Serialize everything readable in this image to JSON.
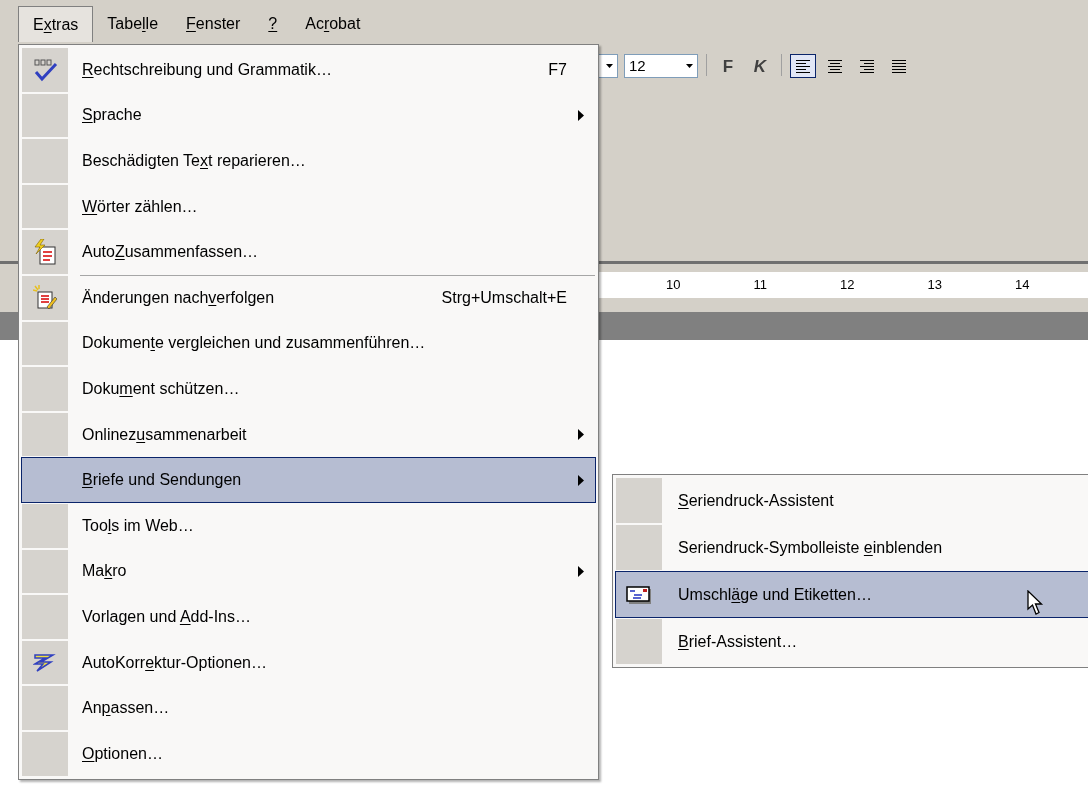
{
  "menubar": [
    {
      "label": {
        "pre": "E",
        "key": "x",
        "post": "tras"
      },
      "selected": true
    },
    {
      "label": {
        "pre": "Tabe",
        "key": "l",
        "post": "le"
      },
      "selected": false
    },
    {
      "label": {
        "key": "F",
        "post": "enster"
      },
      "selected": false
    },
    {
      "label": {
        "key": "?"
      },
      "selected": false
    },
    {
      "label": {
        "pre": "Ac",
        "key": "r",
        "post": "obat"
      },
      "selected": false
    }
  ],
  "toolbar": {
    "font_size": "12",
    "style_buttons": [
      {
        "label": "F",
        "kind": "bold"
      },
      {
        "label": "K",
        "kind": "italic"
      }
    ],
    "align_buttons": [
      {
        "kind": "left",
        "selected": true
      },
      {
        "kind": "center",
        "selected": false
      },
      {
        "kind": "right",
        "selected": false
      },
      {
        "kind": "justify",
        "selected": false
      }
    ]
  },
  "ruler": {
    "numbers": [
      "10",
      "11",
      "12",
      "13",
      "14"
    ]
  },
  "menu": {
    "items": [
      {
        "label": {
          "key": "R",
          "post": "echtschreibung und Grammatik…"
        },
        "shortcut": "F7",
        "has_submenu": false,
        "selected": false,
        "separator_before": false
      },
      {
        "label": {
          "key": "S",
          "post": "prache"
        },
        "has_submenu": true,
        "selected": false,
        "separator_before": false
      },
      {
        "label": {
          "pre": "Beschädigten Te",
          "key": "x",
          "post": "t reparieren…"
        },
        "has_submenu": false,
        "selected": false,
        "separator_before": false
      },
      {
        "label": {
          "key": "W",
          "post": "örter zählen…"
        },
        "has_submenu": false,
        "selected": false,
        "separator_before": false
      },
      {
        "label": {
          "pre": "Auto",
          "key": "Z",
          "post": "usammenfassen…"
        },
        "has_submenu": false,
        "selected": false,
        "separator_before": false
      },
      {
        "label": {
          "pre": "Änderungen nach",
          "key": "v",
          "post": "erfolgen"
        },
        "shortcut": "Strg+Umschalt+E",
        "has_submenu": false,
        "selected": false,
        "separator_before": true
      },
      {
        "label": {
          "pre": "Dokumen",
          "key": "t",
          "post": "e vergleichen und zusammenführen…"
        },
        "has_submenu": false,
        "selected": false,
        "separator_before": false
      },
      {
        "label": {
          "pre": "Doku",
          "key": "m",
          "post": "ent schützen…"
        },
        "has_submenu": false,
        "selected": false,
        "separator_before": false
      },
      {
        "label": {
          "pre": "Onlinez",
          "key": "u",
          "post": "sammenarbeit"
        },
        "has_submenu": true,
        "selected": false,
        "separator_before": false
      },
      {
        "label": {
          "key": "B",
          "post": "riefe und Sendungen"
        },
        "has_submenu": true,
        "selected": true,
        "separator_before": false
      },
      {
        "label": {
          "pre": "Too",
          "key": "l",
          "post": "s im Web…"
        },
        "has_submenu": false,
        "selected": false,
        "separator_before": false
      },
      {
        "label": {
          "pre": "Ma",
          "key": "k",
          "post": "ro"
        },
        "has_submenu": true,
        "selected": false,
        "separator_before": false
      },
      {
        "label": {
          "pre": "Vorlagen und ",
          "key": "A",
          "post": "dd-Ins…"
        },
        "has_submenu": false,
        "selected": false,
        "separator_before": false
      },
      {
        "label": {
          "pre": "AutoKorr",
          "key": "e",
          "post": "ktur-Optionen…"
        },
        "has_submenu": false,
        "selected": false,
        "separator_before": false
      },
      {
        "label": {
          "pre": "An",
          "key": "p",
          "post": "assen…"
        },
        "has_submenu": false,
        "selected": false,
        "separator_before": false
      },
      {
        "label": {
          "key": "O",
          "post": "ptionen…"
        },
        "has_submenu": false,
        "selected": false,
        "separator_before": false
      }
    ]
  },
  "submenu": {
    "items": [
      {
        "label": {
          "key": "S",
          "post": "eriendruck-Assistent"
        },
        "selected": false
      },
      {
        "label": {
          "pre": "Seriendruck-Symbolleiste ",
          "key": "e",
          "post": "inblenden"
        },
        "selected": false
      },
      {
        "label": {
          "pre": "Umschl",
          "key": "ä",
          "post": "ge und Etiketten…"
        },
        "selected": true
      },
      {
        "label": {
          "key": "B",
          "post": "rief-Assistent…"
        },
        "selected": false
      }
    ]
  }
}
